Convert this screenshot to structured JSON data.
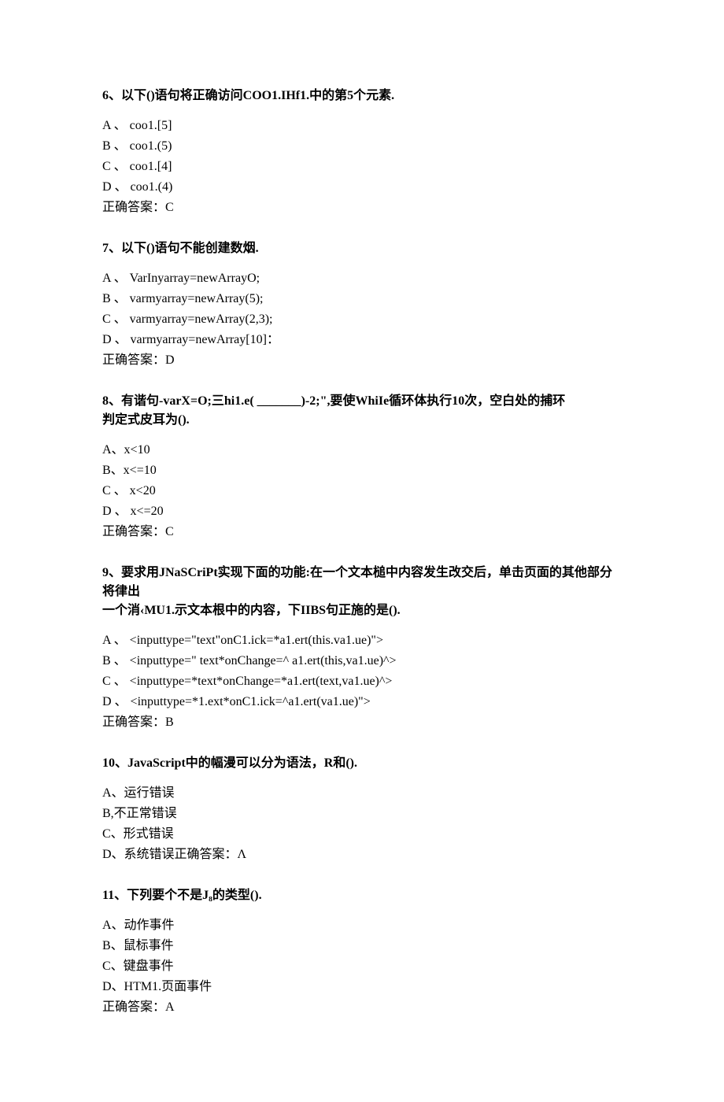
{
  "q6": {
    "stem": "6、以下()语句将正确访问COO1.IHf1.中的第5个元素.",
    "a": "A 、 coo1.[5]",
    "b": "B 、 coo1.(5)",
    "c": "C 、 coo1.[4]",
    "d": "D 、 coo1.(4)",
    "ans": "正确答案：C"
  },
  "q7": {
    "stem": "7、以下()语句不能创建数烟.",
    "a": "A 、 VarInyarray=newArrayO;",
    "b": "B 、 varmyarray=newArray(5);",
    "c": "C 、 varmyarray=newArray(2,3);",
    "d": "D 、 varmyarray=newArray[10]：",
    "ans": "正确答案：D"
  },
  "q8": {
    "stem1": "8、有谐句-varX=O;三hi1.e( _______)-2;\",要使WhiIe循环体执行10次，空白处的捕环",
    "stem2": "判定式皮耳为().",
    "a": "A、x<10",
    "b": "B、x<=10",
    "c": "C 、 x<20",
    "d": "D 、 x<=20",
    "ans": "正确答案：C"
  },
  "q9": {
    "stem1": "9、要求用JNaSCriPt实现下面的功能:在一个文本槌中内容发生改交后，单击页面的其他部分将律出",
    "stem2": "一个消‹MU1.示文本根中的内容，下IIBS句正施的是().",
    "a": "A 、 <inputtype=\"text\"onC1.ick=*a1.ert(this.va1.ue)\">",
    "b": "B 、 <inputtype=\" text*onChange=^ a1.ert(this,va1.ue)^>",
    "c": "C 、 <inputtype=*text*onChange=*a1.ert(text,va1.ue)^>",
    "d": "D 、 <inputtype=*1.ext*onC1.ick=^a1.ert(va1.ue)\">",
    "ans": "正确答案：B"
  },
  "q10": {
    "stem": "10、JavaScript中的幅漫可以分为语法，R和().",
    "a": "A、运行错误",
    "b": "B,不正常错误",
    "c": "C、形式错误",
    "d": "D、系统错误正确答案：Λ"
  },
  "q11": {
    "stem": "11、下列要个不是J₈的类型().",
    "a": "A、动作事件",
    "b": "B、鼠标事件",
    "c": "C、键盘事件",
    "d": "D、HTM1.页面事件",
    "ans": "正确答案：A"
  }
}
